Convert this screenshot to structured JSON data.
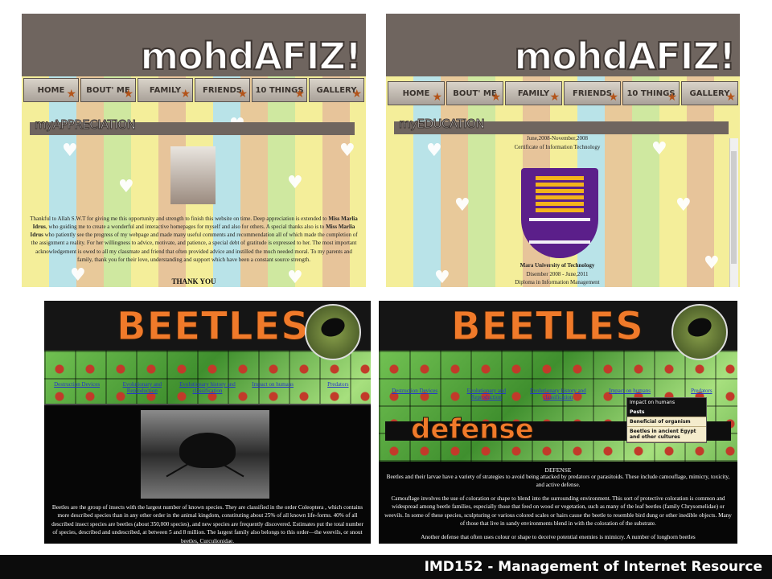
{
  "site1": {
    "logo": "mohdAFIZ!",
    "nav": [
      "HOME",
      "BOUT' ME",
      "FAMILY",
      "FRIENDS",
      "10 THINGS",
      "GALLERY"
    ],
    "appreciation": {
      "heading": "myAPPRECIATION",
      "text_before_1": "Thankful to Allah S.W.T for giving me this opportunity and strength to finish this website on time. Deep appreciation is extended to ",
      "name_1": "Miss Marlia Idrus",
      "text_before_2": ", who guiding me to create a wonderful and interactive homepages for myself and also for others. A special thanks also is to ",
      "name_2": "Miss Marlia Idrus",
      "text_rest": " who patiently see the progress of my webpage and made many useful comments and recommendation all of which made the completion of the assignment a reality. For her willingness to advice, motivate, and patience, a special debt of gratitude is expressed to her. The most important acknowledgement is owed to all my classmate and friend that often provided advice and instilled the much needed moral. To my parents and family, thank you for their love, understanding and support which have been a constant source strength.",
      "thank_you": "THANK YOU"
    },
    "education": {
      "heading": "myEDUCATION",
      "line1": "June,2008-November,2008",
      "line2": "Certificate of Information Technology",
      "uni": "Mara University of Technology",
      "dates": "Disember 2008 - June,2011",
      "diploma": "Diploma in Information Management"
    }
  },
  "site2": {
    "title": "BEETLES",
    "links": [
      "Destruction Devices",
      "Evolutionary and Reproduction",
      "Evolutionary history and classification",
      "Impact on humans",
      "Predators"
    ],
    "main_text": "Beetles are the group of insects with the largest number of known species. They are classified in the order Coleoptera , which contains more described species than in any other order in the animal kingdom, constituting about 25% of all known life-forms. 40% of all described insect species are beetles (about 350,000 species), and new species are frequently discovered. Estimates put the total number of species, described and undescribed, at between 5 and 8 million. The largest family also belongs to this order—the weevils, or snout beetles, Curculionidae.",
    "defense_title": "defense",
    "defense_heading": "DEFENSE",
    "defense_p1": "Beetles and their larvae have a variety of strategies to avoid being attacked by predators or parasitoids. These include camouflage, mimicry, toxicity, and active defense.",
    "defense_p2": "Camouflage involves the use of coloration or shape to blend into the surrounding environment. This sort of protective coloration is common and widespread among beetle families, especially those that feed on wood or vegetation, such as many of the leaf beetles (family Chrysomelidae) or weevils. In some of these species, sculpturing or various colored scales or hairs cause the beetle to resemble bird dung or other inedible objects. Many of those that live in sandy environments blend in with the coloration of the substrate.",
    "defense_p3": "Another defense that often uses colour or shape to deceive potential enemies is mimicry. A number of longhorn beetles",
    "dropdown_header": "Impact on humans",
    "dropdown": [
      "Pests",
      "Beneficial of organism",
      "Beetles in ancient Egypt and other cultures"
    ]
  },
  "footer": "IMD152 - Management of Internet Resource"
}
